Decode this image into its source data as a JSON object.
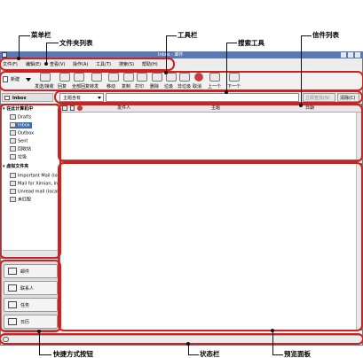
{
  "window": {
    "title": "Inbox - 邮件"
  },
  "menu": [
    "文件(F)",
    "编辑(E)",
    "查看(V)",
    "操作(A)",
    "工具(T)",
    "搜索(S)",
    "帮助(H)"
  ],
  "toolbar": {
    "new_label": "新建",
    "send_receive": "发送/接收",
    "buttons": [
      "回复",
      "全部回复",
      "转发",
      "移动",
      "复制",
      "打印",
      "删除",
      "垃圾",
      "非垃圾",
      "取消",
      "上一个",
      "下一个"
    ]
  },
  "current_folder": "Inbox",
  "search": {
    "option": "主题含有",
    "find_now": "立即查找(N)",
    "clear": "清除(C)"
  },
  "folder_tree": {
    "local_header": "在此计算机中",
    "local": [
      "Drafts",
      "Inbox",
      "Outbox",
      "Sent",
      "回收站",
      "垃圾"
    ],
    "vfolder_header": "虚拟文件夹",
    "vfolders": [
      "Important Mail (local)",
      "Mail for Ximian, Inc",
      "Unread mail (local)",
      "未匹配"
    ]
  },
  "message_list": {
    "columns": [
      "发件人",
      "主题",
      "日期"
    ]
  },
  "shortcuts": [
    "邮件",
    "联系人",
    "任务",
    "日历"
  ],
  "annotations": {
    "menubar": "菜单栏",
    "folder_list": "文件夹列表",
    "toolbar": "工具栏",
    "search_tool": "搜索工具",
    "message_list": "信件列表",
    "shortcut_buttons": "快捷方式按钮",
    "status_bar": "状态栏",
    "preview_pane": "预览面板"
  },
  "colors": {
    "callout": "#d21f1f",
    "titlebar": "#5a78b3"
  }
}
